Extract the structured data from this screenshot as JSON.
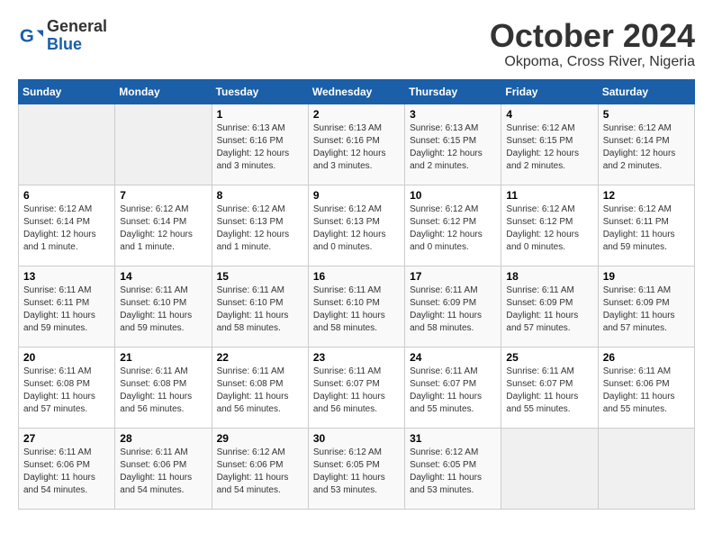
{
  "header": {
    "logo_general": "General",
    "logo_blue": "Blue",
    "title": "October 2024",
    "subtitle": "Okpoma, Cross River, Nigeria"
  },
  "weekdays": [
    "Sunday",
    "Monday",
    "Tuesday",
    "Wednesday",
    "Thursday",
    "Friday",
    "Saturday"
  ],
  "weeks": [
    [
      {
        "day": "",
        "empty": true
      },
      {
        "day": "",
        "empty": true
      },
      {
        "day": "1",
        "sunrise": "6:13 AM",
        "sunset": "6:16 PM",
        "daylight": "12 hours and 3 minutes."
      },
      {
        "day": "2",
        "sunrise": "6:13 AM",
        "sunset": "6:16 PM",
        "daylight": "12 hours and 3 minutes."
      },
      {
        "day": "3",
        "sunrise": "6:13 AM",
        "sunset": "6:15 PM",
        "daylight": "12 hours and 2 minutes."
      },
      {
        "day": "4",
        "sunrise": "6:12 AM",
        "sunset": "6:15 PM",
        "daylight": "12 hours and 2 minutes."
      },
      {
        "day": "5",
        "sunrise": "6:12 AM",
        "sunset": "6:14 PM",
        "daylight": "12 hours and 2 minutes."
      }
    ],
    [
      {
        "day": "6",
        "sunrise": "6:12 AM",
        "sunset": "6:14 PM",
        "daylight": "12 hours and 1 minute."
      },
      {
        "day": "7",
        "sunrise": "6:12 AM",
        "sunset": "6:14 PM",
        "daylight": "12 hours and 1 minute."
      },
      {
        "day": "8",
        "sunrise": "6:12 AM",
        "sunset": "6:13 PM",
        "daylight": "12 hours and 1 minute."
      },
      {
        "day": "9",
        "sunrise": "6:12 AM",
        "sunset": "6:13 PM",
        "daylight": "12 hours and 0 minutes."
      },
      {
        "day": "10",
        "sunrise": "6:12 AM",
        "sunset": "6:12 PM",
        "daylight": "12 hours and 0 minutes."
      },
      {
        "day": "11",
        "sunrise": "6:12 AM",
        "sunset": "6:12 PM",
        "daylight": "12 hours and 0 minutes."
      },
      {
        "day": "12",
        "sunrise": "6:12 AM",
        "sunset": "6:11 PM",
        "daylight": "11 hours and 59 minutes."
      }
    ],
    [
      {
        "day": "13",
        "sunrise": "6:11 AM",
        "sunset": "6:11 PM",
        "daylight": "11 hours and 59 minutes."
      },
      {
        "day": "14",
        "sunrise": "6:11 AM",
        "sunset": "6:10 PM",
        "daylight": "11 hours and 59 minutes."
      },
      {
        "day": "15",
        "sunrise": "6:11 AM",
        "sunset": "6:10 PM",
        "daylight": "11 hours and 58 minutes."
      },
      {
        "day": "16",
        "sunrise": "6:11 AM",
        "sunset": "6:10 PM",
        "daylight": "11 hours and 58 minutes."
      },
      {
        "day": "17",
        "sunrise": "6:11 AM",
        "sunset": "6:09 PM",
        "daylight": "11 hours and 58 minutes."
      },
      {
        "day": "18",
        "sunrise": "6:11 AM",
        "sunset": "6:09 PM",
        "daylight": "11 hours and 57 minutes."
      },
      {
        "day": "19",
        "sunrise": "6:11 AM",
        "sunset": "6:09 PM",
        "daylight": "11 hours and 57 minutes."
      }
    ],
    [
      {
        "day": "20",
        "sunrise": "6:11 AM",
        "sunset": "6:08 PM",
        "daylight": "11 hours and 57 minutes."
      },
      {
        "day": "21",
        "sunrise": "6:11 AM",
        "sunset": "6:08 PM",
        "daylight": "11 hours and 56 minutes."
      },
      {
        "day": "22",
        "sunrise": "6:11 AM",
        "sunset": "6:08 PM",
        "daylight": "11 hours and 56 minutes."
      },
      {
        "day": "23",
        "sunrise": "6:11 AM",
        "sunset": "6:07 PM",
        "daylight": "11 hours and 56 minutes."
      },
      {
        "day": "24",
        "sunrise": "6:11 AM",
        "sunset": "6:07 PM",
        "daylight": "11 hours and 55 minutes."
      },
      {
        "day": "25",
        "sunrise": "6:11 AM",
        "sunset": "6:07 PM",
        "daylight": "11 hours and 55 minutes."
      },
      {
        "day": "26",
        "sunrise": "6:11 AM",
        "sunset": "6:06 PM",
        "daylight": "11 hours and 55 minutes."
      }
    ],
    [
      {
        "day": "27",
        "sunrise": "6:11 AM",
        "sunset": "6:06 PM",
        "daylight": "11 hours and 54 minutes."
      },
      {
        "day": "28",
        "sunrise": "6:11 AM",
        "sunset": "6:06 PM",
        "daylight": "11 hours and 54 minutes."
      },
      {
        "day": "29",
        "sunrise": "6:12 AM",
        "sunset": "6:06 PM",
        "daylight": "11 hours and 54 minutes."
      },
      {
        "day": "30",
        "sunrise": "6:12 AM",
        "sunset": "6:05 PM",
        "daylight": "11 hours and 53 minutes."
      },
      {
        "day": "31",
        "sunrise": "6:12 AM",
        "sunset": "6:05 PM",
        "daylight": "11 hours and 53 minutes."
      },
      {
        "day": "",
        "empty": true
      },
      {
        "day": "",
        "empty": true
      }
    ]
  ]
}
